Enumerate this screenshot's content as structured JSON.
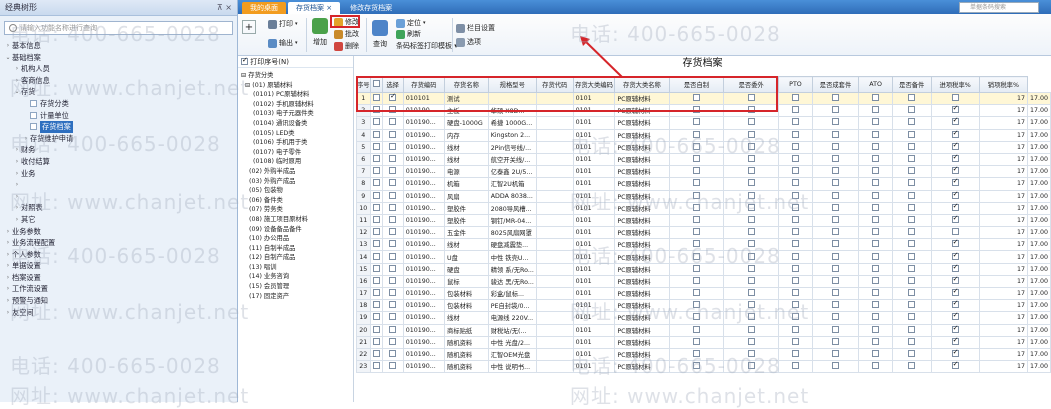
{
  "sidebar": {
    "title": "经典树形",
    "pin": "⊼ ×",
    "search_placeholder": "请输入功能名称进行查询",
    "items": [
      {
        "label": "基本信息",
        "indent": 0,
        "arrow": "›"
      },
      {
        "label": "基础档案",
        "indent": 0,
        "arrow": "⌄"
      },
      {
        "label": "机构人员",
        "indent": 1,
        "arrow": "›"
      },
      {
        "label": "客商信息",
        "indent": 1,
        "arrow": "›"
      },
      {
        "label": "存货",
        "indent": 1,
        "arrow": "⌄"
      },
      {
        "label": "存货分类",
        "indent": 2,
        "arrow": "",
        "file": true
      },
      {
        "label": "计量单位",
        "indent": 2,
        "arrow": "",
        "file": true
      },
      {
        "label": "存货档案",
        "indent": 2,
        "arrow": "",
        "file": true,
        "selected": true
      },
      {
        "label": "存货维护申请",
        "indent": 2,
        "arrow": "›"
      },
      {
        "label": "财务",
        "indent": 1,
        "arrow": "›"
      },
      {
        "label": "收付结算",
        "indent": 1,
        "arrow": "›"
      },
      {
        "label": "业务",
        "indent": 1,
        "arrow": "›"
      },
      {
        "label": "",
        "indent": 1,
        "arrow": "›"
      },
      {
        "label": "",
        "indent": 1,
        "arrow": "›"
      },
      {
        "label": "对照表",
        "indent": 1,
        "arrow": "›"
      },
      {
        "label": "其它",
        "indent": 1,
        "arrow": "›"
      },
      {
        "label": "业务参数",
        "indent": 0,
        "arrow": "›"
      },
      {
        "label": "业务流程配置",
        "indent": 0,
        "arrow": "›"
      },
      {
        "label": "个人参数",
        "indent": 0,
        "arrow": "›"
      },
      {
        "label": "单据设置",
        "indent": 0,
        "arrow": "›"
      },
      {
        "label": "档案设置",
        "indent": 0,
        "arrow": "›"
      },
      {
        "label": "工作流设置",
        "indent": 0,
        "arrow": "›"
      },
      {
        "label": "预警与通知",
        "indent": 0,
        "arrow": "›"
      },
      {
        "label": "友空间",
        "indent": 0,
        "arrow": "›"
      }
    ]
  },
  "tabs": {
    "home": "我的桌面",
    "active": "存货档案 ×",
    "other": "修改存货档案",
    "search_placeholder": "单据条码搜索"
  },
  "toolbar": {
    "print": "打印",
    "export": "输出",
    "add": "增加",
    "modify": "修改",
    "batch": "批改",
    "delete": "删除",
    "query": "查询",
    "locate": "定位",
    "refresh": "刷新",
    "barcode_print": "条码标签打印模板 ▾",
    "column_setting": "栏目设置",
    "options": "选项"
  },
  "left": {
    "print_seq": "打印序号(N)",
    "tree": [
      "⊟ 存货分类",
      "  ⊟ (01) 原辅材料",
      "      (0101) PC原辅材料",
      "      (0102) 手机原辅材料",
      "      (0103) 电子元器件类",
      "      (0104) 通讯设备类",
      "      (0105) LED类",
      "      (0106) 手机用于类",
      "      (0107) 电子零件",
      "      (0108) 临时原用",
      "    (02) 外购半成品",
      "    (03) 外购产成品",
      "    (05) 包装物",
      "    (06) 备件类",
      "    (07) 劳务类",
      "    (08) 施工项目原材料",
      "    (09) 设备备品备件",
      "    (10) 办公用品",
      "    (11) 自制半成品",
      "    (12) 自制产成品",
      "    (13) 唱训",
      "    (14) 业务咨询",
      "    (15) 会员管理",
      "    (17) 固定资产"
    ]
  },
  "grid": {
    "title": "存货档案",
    "headers": [
      "序号",
      "",
      "选择",
      "存货编码",
      "存货名称",
      "规格型号",
      "存货代码",
      "存货大类编码",
      "存货大类名称",
      "是否自制",
      "是否委外",
      "PTO",
      "是否成套件",
      "ATO",
      "是否备件",
      "进项税率%",
      "销项税率%"
    ],
    "rows": [
      [
        "1",
        "✓",
        "010101",
        "测试",
        "",
        "0101",
        "PC原辅材料",
        "",
        "",
        "",
        "",
        "",
        "",
        "",
        "17",
        "17.00"
      ],
      [
        "2",
        "",
        "010190...",
        "主板",
        "华硕 X8D...",
        "0101",
        "PC原辅材料",
        "",
        "",
        "",
        "",
        "",
        "",
        "✓",
        "17",
        "17.00"
      ],
      [
        "3",
        "",
        "010190...",
        "硬盘-1000G",
        "希捷 1000G...",
        "0101",
        "PC原辅材料",
        "",
        "",
        "",
        "",
        "",
        "",
        "✓",
        "17",
        "17.00"
      ],
      [
        "4",
        "",
        "010190...",
        "内存",
        "Kingston 2...",
        "0101",
        "PC原辅材料",
        "",
        "",
        "",
        "",
        "",
        "",
        "✓",
        "17",
        "17.00"
      ],
      [
        "5",
        "",
        "010190...",
        "线材",
        "2Pin信号线/...",
        "0101",
        "PC原辅材料",
        "",
        "",
        "",
        "",
        "",
        "",
        "✓",
        "17",
        "17.00"
      ],
      [
        "6",
        "",
        "010190...",
        "线材",
        "航空开关线/...",
        "0101",
        "PC原辅材料",
        "",
        "",
        "",
        "",
        "",
        "",
        "✓",
        "17",
        "17.00"
      ],
      [
        "7",
        "",
        "010190...",
        "电源",
        "亿泰鑫 2U/5...",
        "0101",
        "PC原辅材料",
        "",
        "",
        "",
        "",
        "",
        "",
        "✓",
        "17",
        "17.00"
      ],
      [
        "8",
        "",
        "010190...",
        "机箱",
        "汇智2U机箱",
        "0101",
        "PC原辅材料",
        "",
        "",
        "",
        "",
        "",
        "",
        "✓",
        "17",
        "17.00"
      ],
      [
        "9",
        "",
        "010190...",
        "风扇",
        "ADDA 8038...",
        "0101",
        "PC原辅材料",
        "",
        "",
        "",
        "",
        "",
        "",
        "✓",
        "17",
        "17.00"
      ],
      [
        "10",
        "",
        "010190...",
        "塑胶件",
        "2080导风槽...",
        "0101",
        "PC原辅材料",
        "",
        "",
        "",
        "",
        "",
        "",
        "✓",
        "17",
        "17.00"
      ],
      [
        "11",
        "",
        "010190...",
        "塑胶件",
        "钢钉/MR-04...",
        "0101",
        "PC原辅材料",
        "",
        "",
        "",
        "",
        "",
        "",
        "✓",
        "17",
        "17.00"
      ],
      [
        "12",
        "",
        "010190...",
        "五金件",
        "8025风扇网罩",
        "0101",
        "PC原辅材料",
        "",
        "",
        "",
        "",
        "",
        "",
        "",
        "17",
        "17.00"
      ],
      [
        "13",
        "",
        "010190...",
        "线材",
        "硬盘减震垫...",
        "0101",
        "PC原辅材料",
        "",
        "",
        "",
        "",
        "",
        "",
        "✓",
        "17",
        "17.00"
      ],
      [
        "14",
        "",
        "010190...",
        "U盘",
        "中性 铁壳U...",
        "0101",
        "PC原辅材料",
        "",
        "",
        "",
        "",
        "",
        "",
        "✓",
        "17",
        "17.00"
      ],
      [
        "15",
        "",
        "010190...",
        "硬盘",
        "精领 系/无Ro...",
        "0101",
        "PC原辅材料",
        "",
        "",
        "",
        "",
        "",
        "",
        "✓",
        "17",
        "17.00"
      ],
      [
        "16",
        "",
        "010190...",
        "鼠标",
        "骏达 黑/无Ro...",
        "0101",
        "PC原辅材料",
        "",
        "",
        "",
        "",
        "",
        "",
        "✓",
        "17",
        "17.00"
      ],
      [
        "17",
        "",
        "010190...",
        "包装材料",
        "彩盒/鼠标...",
        "0101",
        "PC原辅材料",
        "",
        "",
        "",
        "",
        "",
        "",
        "✓",
        "17",
        "17.00"
      ],
      [
        "18",
        "",
        "010190...",
        "包装材料",
        "PE自封袋/0...",
        "0101",
        "PC原辅材料",
        "",
        "",
        "",
        "",
        "",
        "",
        "✓",
        "17",
        "17.00"
      ],
      [
        "19",
        "",
        "010190...",
        "线材",
        "电源线 220V...",
        "0101",
        "PC原辅材料",
        "",
        "",
        "",
        "",
        "",
        "",
        "✓",
        "17",
        "17.00"
      ],
      [
        "20",
        "",
        "010190...",
        "商标贴纸",
        "财税站/无(...",
        "0101",
        "PC原辅材料",
        "",
        "",
        "",
        "",
        "",
        "",
        "✓",
        "17",
        "17.00"
      ],
      [
        "21",
        "",
        "010190...",
        "随机资料",
        "中性 光盘/2...",
        "0101",
        "PC原辅材料",
        "",
        "",
        "",
        "",
        "",
        "",
        "✓",
        "17",
        "17.00"
      ],
      [
        "22",
        "",
        "010190...",
        "随机资料",
        "汇智OEM光盘",
        "0101",
        "PC原辅材料",
        "",
        "",
        "",
        "",
        "",
        "",
        "✓",
        "17",
        "17.00"
      ],
      [
        "23",
        "",
        "010190...",
        "随机资料",
        "中性 说明书...",
        "0101",
        "PC原辅材料",
        "",
        "",
        "",
        "",
        "",
        "",
        "✓",
        "17",
        "17.00"
      ]
    ]
  },
  "watermark": {
    "phone": "电话: 400-665-0028",
    "site": "网址: www.chanjet.net"
  },
  "colors": {
    "accent": "#2e6fbf",
    "highlight": "#d6252a",
    "home_tab": "#f29c1f"
  }
}
